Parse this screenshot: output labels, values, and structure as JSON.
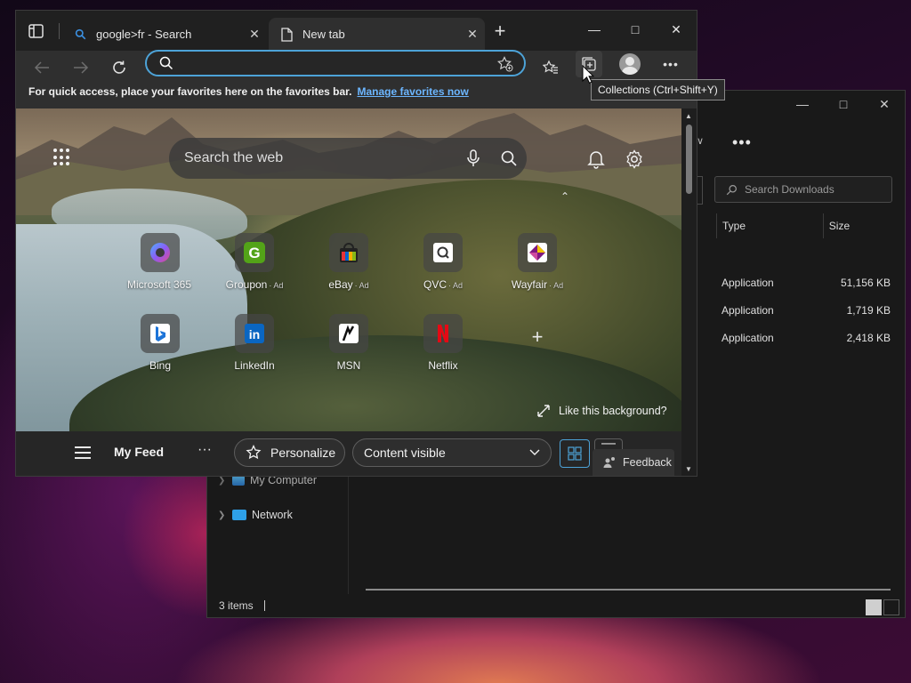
{
  "browser": {
    "tabs": [
      {
        "label": "google>fr - Search",
        "state": "inactive",
        "icon": "bing-search-icon"
      },
      {
        "label": "New tab",
        "state": "active",
        "icon": "page-icon"
      }
    ],
    "address_bar": {
      "value": "",
      "placeholder": ""
    },
    "favorites_bar": {
      "text": "For quick access, place your favorites here on the favorites bar.",
      "link": "Manage favorites now"
    },
    "tooltip": "Collections (Ctrl+Shift+Y)",
    "accent": "#4da3d8"
  },
  "new_tab_page": {
    "search_placeholder": "Search the web",
    "tiles": [
      {
        "label": "Microsoft 365",
        "ad": ""
      },
      {
        "label": "Groupon",
        "ad": "· Ad"
      },
      {
        "label": "eBay",
        "ad": "· Ad"
      },
      {
        "label": "QVC",
        "ad": "· Ad"
      },
      {
        "label": "Wayfair",
        "ad": "· Ad"
      },
      {
        "label": "Bing",
        "ad": ""
      },
      {
        "label": "LinkedIn",
        "ad": ""
      },
      {
        "label": "MSN",
        "ad": ""
      },
      {
        "label": "Netflix",
        "ad": ""
      }
    ],
    "like_background": "Like this background?",
    "feed": {
      "title": "My Feed",
      "more": "···",
      "personalize": "Personalize",
      "content_select": "Content visible",
      "feedback": "Feedback"
    }
  },
  "explorer": {
    "search_placeholder": "Search Downloads",
    "columns": {
      "type": "Type",
      "size": "Size"
    },
    "rows": [
      {
        "type": "Application",
        "size": "51,156 KB"
      },
      {
        "type": "Application",
        "size": "1,719 KB"
      },
      {
        "type": "Application",
        "size": "2,418 KB"
      }
    ],
    "nav": {
      "my_computer": "My Computer",
      "network": "Network"
    },
    "status": "3 items"
  }
}
